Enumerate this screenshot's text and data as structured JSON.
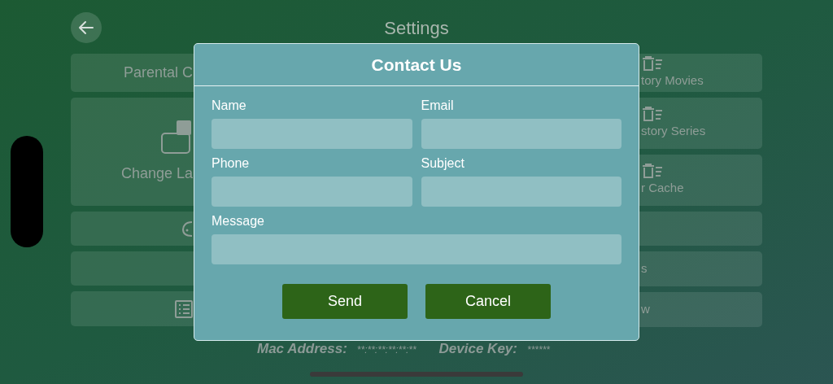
{
  "header": {
    "title": "Settings"
  },
  "left_items": [
    {
      "kind": "text",
      "label": "Parental C"
    },
    {
      "kind": "language",
      "label": "Change La"
    },
    {
      "kind": "theme"
    },
    {
      "kind": "blank"
    },
    {
      "kind": "list"
    }
  ],
  "right_items": [
    {
      "kind": "trash",
      "label": "tory Movies"
    },
    {
      "kind": "trash",
      "label": "story Series"
    },
    {
      "kind": "trash",
      "label": "r Cache"
    },
    {
      "kind": "blank"
    },
    {
      "kind": "text",
      "label": "s"
    },
    {
      "kind": "text",
      "label": "w"
    }
  ],
  "footer": {
    "mac_label": "Mac Address:",
    "mac_value": "**:**:**:**:**:**",
    "key_label": "Device Key:",
    "key_value": "******"
  },
  "dialog": {
    "title": "Contact Us",
    "fields": [
      {
        "label": "Name"
      },
      {
        "label": "Email"
      },
      {
        "label": "Phone"
      },
      {
        "label": "Subject"
      },
      {
        "label": "Message",
        "wide": true
      }
    ],
    "buttons": [
      "Send",
      "Cancel"
    ]
  }
}
